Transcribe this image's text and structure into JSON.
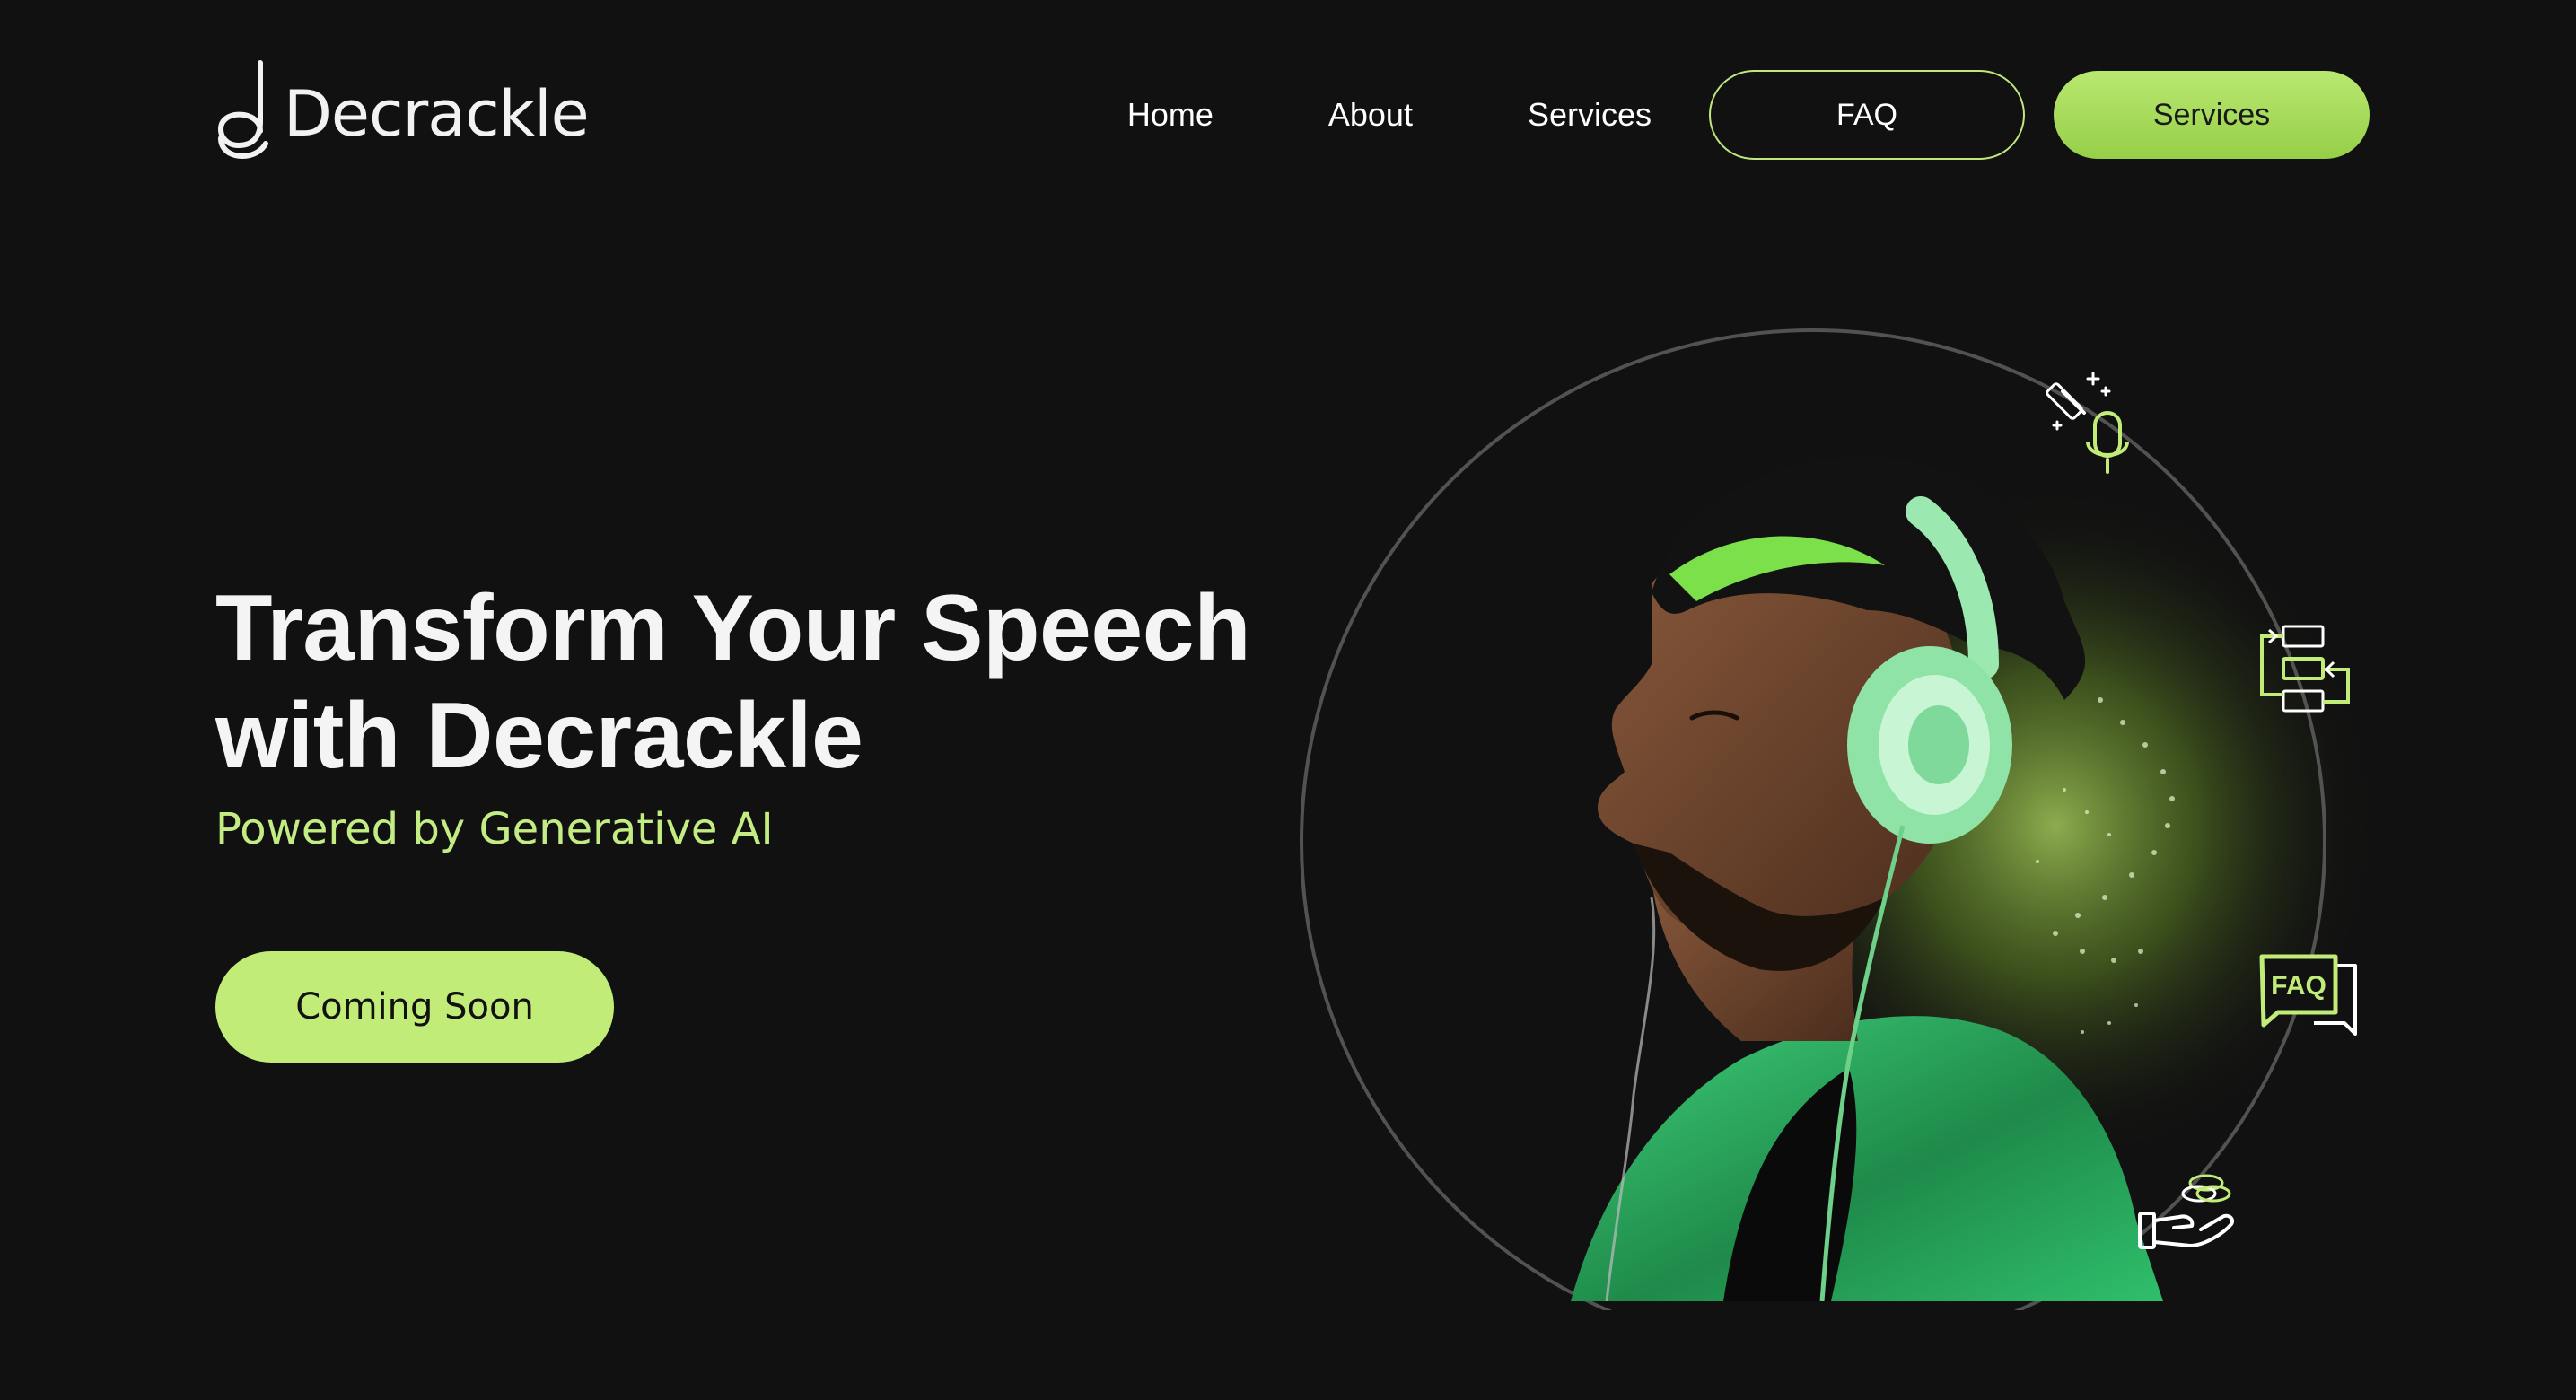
{
  "brand": {
    "name": "Decrackle",
    "logo_icon": "music-note-logo-icon"
  },
  "nav": {
    "links": [
      "Home",
      "About",
      "Services"
    ],
    "faq_button": "FAQ",
    "services_button": "Services"
  },
  "hero": {
    "title_line1": "Transform Your Speech",
    "title_line2": "with Decrackle",
    "subtitle": "Powered by Generative AI",
    "cta_label": "Coming Soon"
  },
  "orbit_icons": {
    "icons": [
      "magic-wand-microphone-icon",
      "workflow-blocks-icon",
      "faq-chat-icon",
      "hand-coins-icon"
    ],
    "faq_icon_text": "FAQ"
  },
  "colors": {
    "background": "#111111",
    "accent": "#c1ec78",
    "accent_dark": "#96cf48",
    "text": "#ffffff"
  }
}
